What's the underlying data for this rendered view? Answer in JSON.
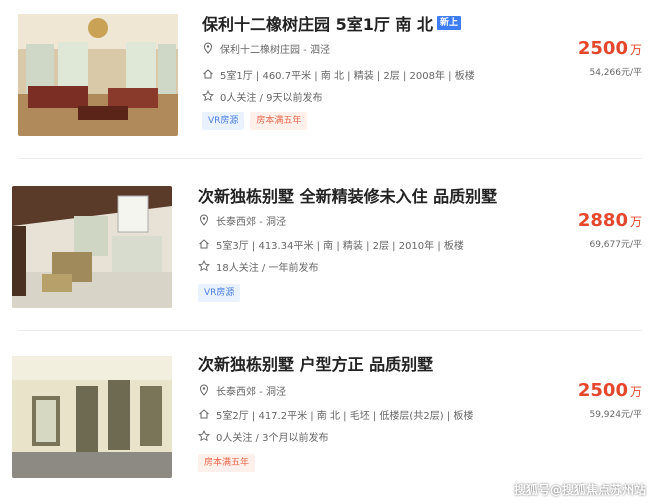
{
  "listings": [
    {
      "title": "保利十二橡树庄园 5室1厅 南 北",
      "badge": "新上",
      "location": "保利十二橡树庄园 - 泗泾",
      "details": "5室1厅 | 460.7平米 | 南 北 | 精装 | 2层 | 2008年 | 板楼",
      "followers": "0人关注 / 9天以前发布",
      "tags": [
        "VR房源",
        "房本满五年"
      ],
      "price": "2500",
      "price_unit": "万",
      "unit_price": "54,266元/平"
    },
    {
      "title": "次新独栋别墅 全新精装修未入住 品质别墅",
      "location": "长泰西郊 - 洞泾",
      "details": "5室3厅 | 413.34平米 | 南 | 精装 | 2层 | 2010年 | 板楼",
      "followers": "18人关注 / 一年前发布",
      "tags": [
        "VR房源"
      ],
      "price": "2880",
      "price_unit": "万",
      "unit_price": "69,677元/平"
    },
    {
      "title": "次新独栋别墅 户型方正 品质别墅",
      "location": "长泰西郊 - 洞泾",
      "details": "5室2厅 | 417.2平米 | 南 北 | 毛坯 | 低楼层(共2层) | 板楼",
      "followers": "0人关注 / 3个月以前发布",
      "tags": [
        "房本满五年"
      ],
      "price": "2500",
      "price_unit": "万",
      "unit_price": "59,924元/平"
    }
  ],
  "watermark": "搜狐号@搜狐焦点苏州站",
  "icons": {
    "location": "location-pin-icon",
    "house": "house-icon",
    "star": "star-icon"
  },
  "colors": {
    "price": "#e5472c",
    "badge_new": "#3d7ef6",
    "tag_vr": "#4a7fe0",
    "tag_years": "#e8674a"
  }
}
